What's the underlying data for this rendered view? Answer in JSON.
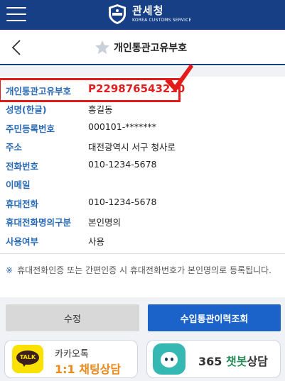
{
  "header": {
    "logo_title": "관세청",
    "logo_subtitle": "KOREA CUSTOMS SERVICE"
  },
  "subheader": {
    "title": "개인통관고유부호"
  },
  "info_rows": [
    {
      "label": "개인통관고유부호",
      "value": "P229876543210"
    },
    {
      "label": "성명(한글)",
      "value": "홍길동"
    },
    {
      "label": "주민등록번호",
      "value": "000101-*******"
    },
    {
      "label": "주소",
      "value": "대전광역시 서구 청사로"
    },
    {
      "label": "전화번호",
      "value": "010-1234-5678"
    },
    {
      "label": "이메일",
      "value": ""
    },
    {
      "label": "휴대전화",
      "value": "010-1234-5678"
    },
    {
      "label": "휴대전화명의구분",
      "value": "본인명의"
    },
    {
      "label": "사용여부",
      "value": "사용"
    }
  ],
  "notice": {
    "mark": "※",
    "text": "휴대전화인증 또는 간편인증 시 휴대전화번호가 본인명의로 등록됩니다."
  },
  "buttons": {
    "edit": "수정",
    "history": "수입통관이력조회"
  },
  "kakao": {
    "icon_text": "TALK",
    "line1": "카카오톡",
    "line2": "1:1 채팅상담"
  },
  "chatbot": {
    "prefix": "365",
    "accent": "챗봇",
    "suffix": "상담"
  },
  "colors": {
    "primary": "#163f85",
    "label_blue": "#2a6ab5",
    "highlight_red": "#e41b1b",
    "button_blue": "#1b63c8"
  },
  "icons": [
    "menu-icon",
    "customs-emblem-icon",
    "back-icon",
    "star-icon",
    "checkmark-icon",
    "kakao-talk-icon",
    "chatbot-icon"
  ]
}
